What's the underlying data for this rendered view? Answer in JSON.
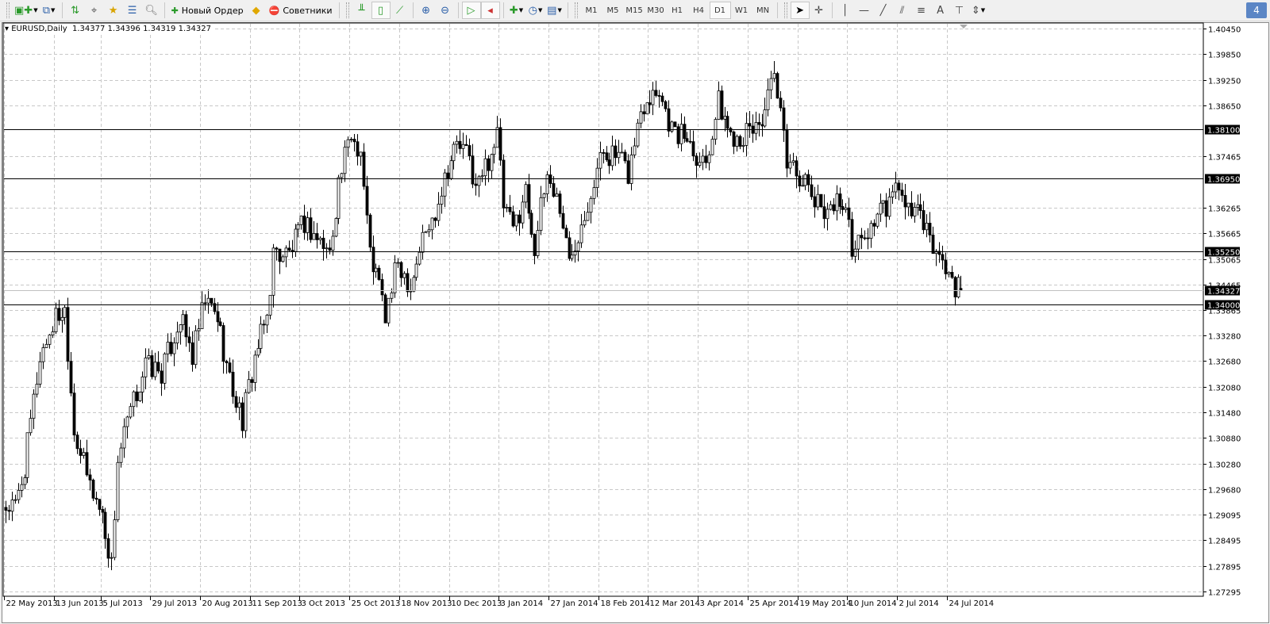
{
  "toolbar": {
    "new_order_label": "Новый Ордер",
    "advisors_label": "Советники",
    "timeframes": [
      "M1",
      "M5",
      "M15",
      "M30",
      "H1",
      "H4",
      "D1",
      "W1",
      "MN"
    ],
    "active_timeframe": "D1",
    "badge": "4"
  },
  "chart": {
    "title": "EURUSD,Daily",
    "ohlc": "1.34377 1.34396 1.34319 1.34327"
  },
  "chart_data": {
    "type": "candlestick",
    "symbol": "EURUSD",
    "period": "Daily",
    "price_axis_labels": [
      "1.40450",
      "1.39850",
      "1.39250",
      "1.38650",
      "1.37465",
      "1.36265",
      "1.35665",
      "1.35065",
      "1.34465",
      "1.33865",
      "1.33280",
      "1.32680",
      "1.32080",
      "1.31480",
      "1.30880",
      "1.30280",
      "1.29680",
      "1.29095",
      "1.28495",
      "1.27895",
      "1.27295"
    ],
    "date_axis_labels": [
      {
        "label": "22 May 2013",
        "bar": 0
      },
      {
        "label": "13 Jun 2013",
        "bar": 16
      },
      {
        "label": "5 Jul 2013",
        "bar": 31
      },
      {
        "label": "29 Jul 2013",
        "bar": 47
      },
      {
        "label": "20 Aug 2013",
        "bar": 63
      },
      {
        "label": "11 Sep 2013",
        "bar": 79
      },
      {
        "label": "3 Oct 2013",
        "bar": 95
      },
      {
        "label": "25 Oct 2013",
        "bar": 111
      },
      {
        "label": "18 Nov 2013",
        "bar": 127
      },
      {
        "label": "10 Dec 2013",
        "bar": 143
      },
      {
        "label": "3 Jan 2014",
        "bar": 159
      },
      {
        "label": "27 Jan 2014",
        "bar": 175
      },
      {
        "label": "18 Feb 2014",
        "bar": 191
      },
      {
        "label": "12 Mar 2014",
        "bar": 207
      },
      {
        "label": "3 Apr 2014",
        "bar": 223
      },
      {
        "label": "25 Apr 2014",
        "bar": 239
      },
      {
        "label": "19 May 2014",
        "bar": 255
      },
      {
        "label": "10 Jun 2014",
        "bar": 271
      },
      {
        "label": "2 Jul 2014",
        "bar": 287
      },
      {
        "label": "24 Jul 2014",
        "bar": 303
      }
    ],
    "horizontal_levels": [
      "1.38100",
      "1.36950",
      "1.35250",
      "1.34000"
    ],
    "current_price": "1.34327",
    "close_path": [
      [
        0,
        1.2926
      ],
      [
        3,
        1.2926
      ],
      [
        6,
        1.3019
      ],
      [
        11,
        1.3278
      ],
      [
        16,
        1.3371
      ],
      [
        19,
        1.3389
      ],
      [
        22,
        1.3111
      ],
      [
        26,
        1.2999
      ],
      [
        31,
        1.2907
      ],
      [
        34,
        1.279
      ],
      [
        36,
        1.3037
      ],
      [
        40,
        1.3148
      ],
      [
        45,
        1.3259
      ],
      [
        50,
        1.3241
      ],
      [
        56,
        1.3371
      ],
      [
        60,
        1.3278
      ],
      [
        64,
        1.3408
      ],
      [
        68,
        1.3371
      ],
      [
        72,
        1.3222
      ],
      [
        76,
        1.313
      ],
      [
        80,
        1.3278
      ],
      [
        84,
        1.3371
      ],
      [
        86,
        1.3519
      ],
      [
        91,
        1.3519
      ],
      [
        96,
        1.3593
      ],
      [
        100,
        1.3556
      ],
      [
        104,
        1.3519
      ],
      [
        107,
        1.3686
      ],
      [
        111,
        1.3797
      ],
      [
        114,
        1.376
      ],
      [
        117,
        1.3519
      ],
      [
        120,
        1.3445
      ],
      [
        122,
        1.3371
      ],
      [
        126,
        1.35
      ],
      [
        130,
        1.3445
      ],
      [
        134,
        1.3556
      ],
      [
        137,
        1.3593
      ],
      [
        141,
        1.3704
      ],
      [
        145,
        1.3778
      ],
      [
        149,
        1.3741
      ],
      [
        151,
        1.3667
      ],
      [
        155,
        1.3741
      ],
      [
        158,
        1.3797
      ],
      [
        160,
        1.363
      ],
      [
        163,
        1.3574
      ],
      [
        167,
        1.3667
      ],
      [
        170,
        1.3537
      ],
      [
        174,
        1.3704
      ],
      [
        178,
        1.363
      ],
      [
        181,
        1.35
      ],
      [
        184,
        1.3574
      ],
      [
        188,
        1.3667
      ],
      [
        192,
        1.376
      ],
      [
        197,
        1.3741
      ],
      [
        200,
        1.3704
      ],
      [
        204,
        1.3852
      ],
      [
        206,
        1.3889
      ],
      [
        210,
        1.3908
      ],
      [
        212,
        1.3852
      ],
      [
        215,
        1.3797
      ],
      [
        219,
        1.3797
      ],
      [
        223,
        1.3741
      ],
      [
        225,
        1.3741
      ],
      [
        229,
        1.3871
      ],
      [
        233,
        1.3797
      ],
      [
        238,
        1.3797
      ],
      [
        243,
        1.3834
      ],
      [
        247,
        1.3926
      ],
      [
        249,
        1.3834
      ],
      [
        251,
        1.3741
      ],
      [
        255,
        1.3704
      ],
      [
        258,
        1.3667
      ],
      [
        261,
        1.363
      ],
      [
        265,
        1.363
      ],
      [
        269,
        1.3648
      ],
      [
        272,
        1.3537
      ],
      [
        276,
        1.3556
      ],
      [
        280,
        1.3611
      ],
      [
        284,
        1.363
      ],
      [
        287,
        1.3686
      ],
      [
        289,
        1.3611
      ],
      [
        293,
        1.363
      ],
      [
        295,
        1.3574
      ],
      [
        298,
        1.3537
      ],
      [
        302,
        1.3482
      ],
      [
        306,
        1.3435
      ],
      [
        307,
        1.34327
      ]
    ]
  }
}
